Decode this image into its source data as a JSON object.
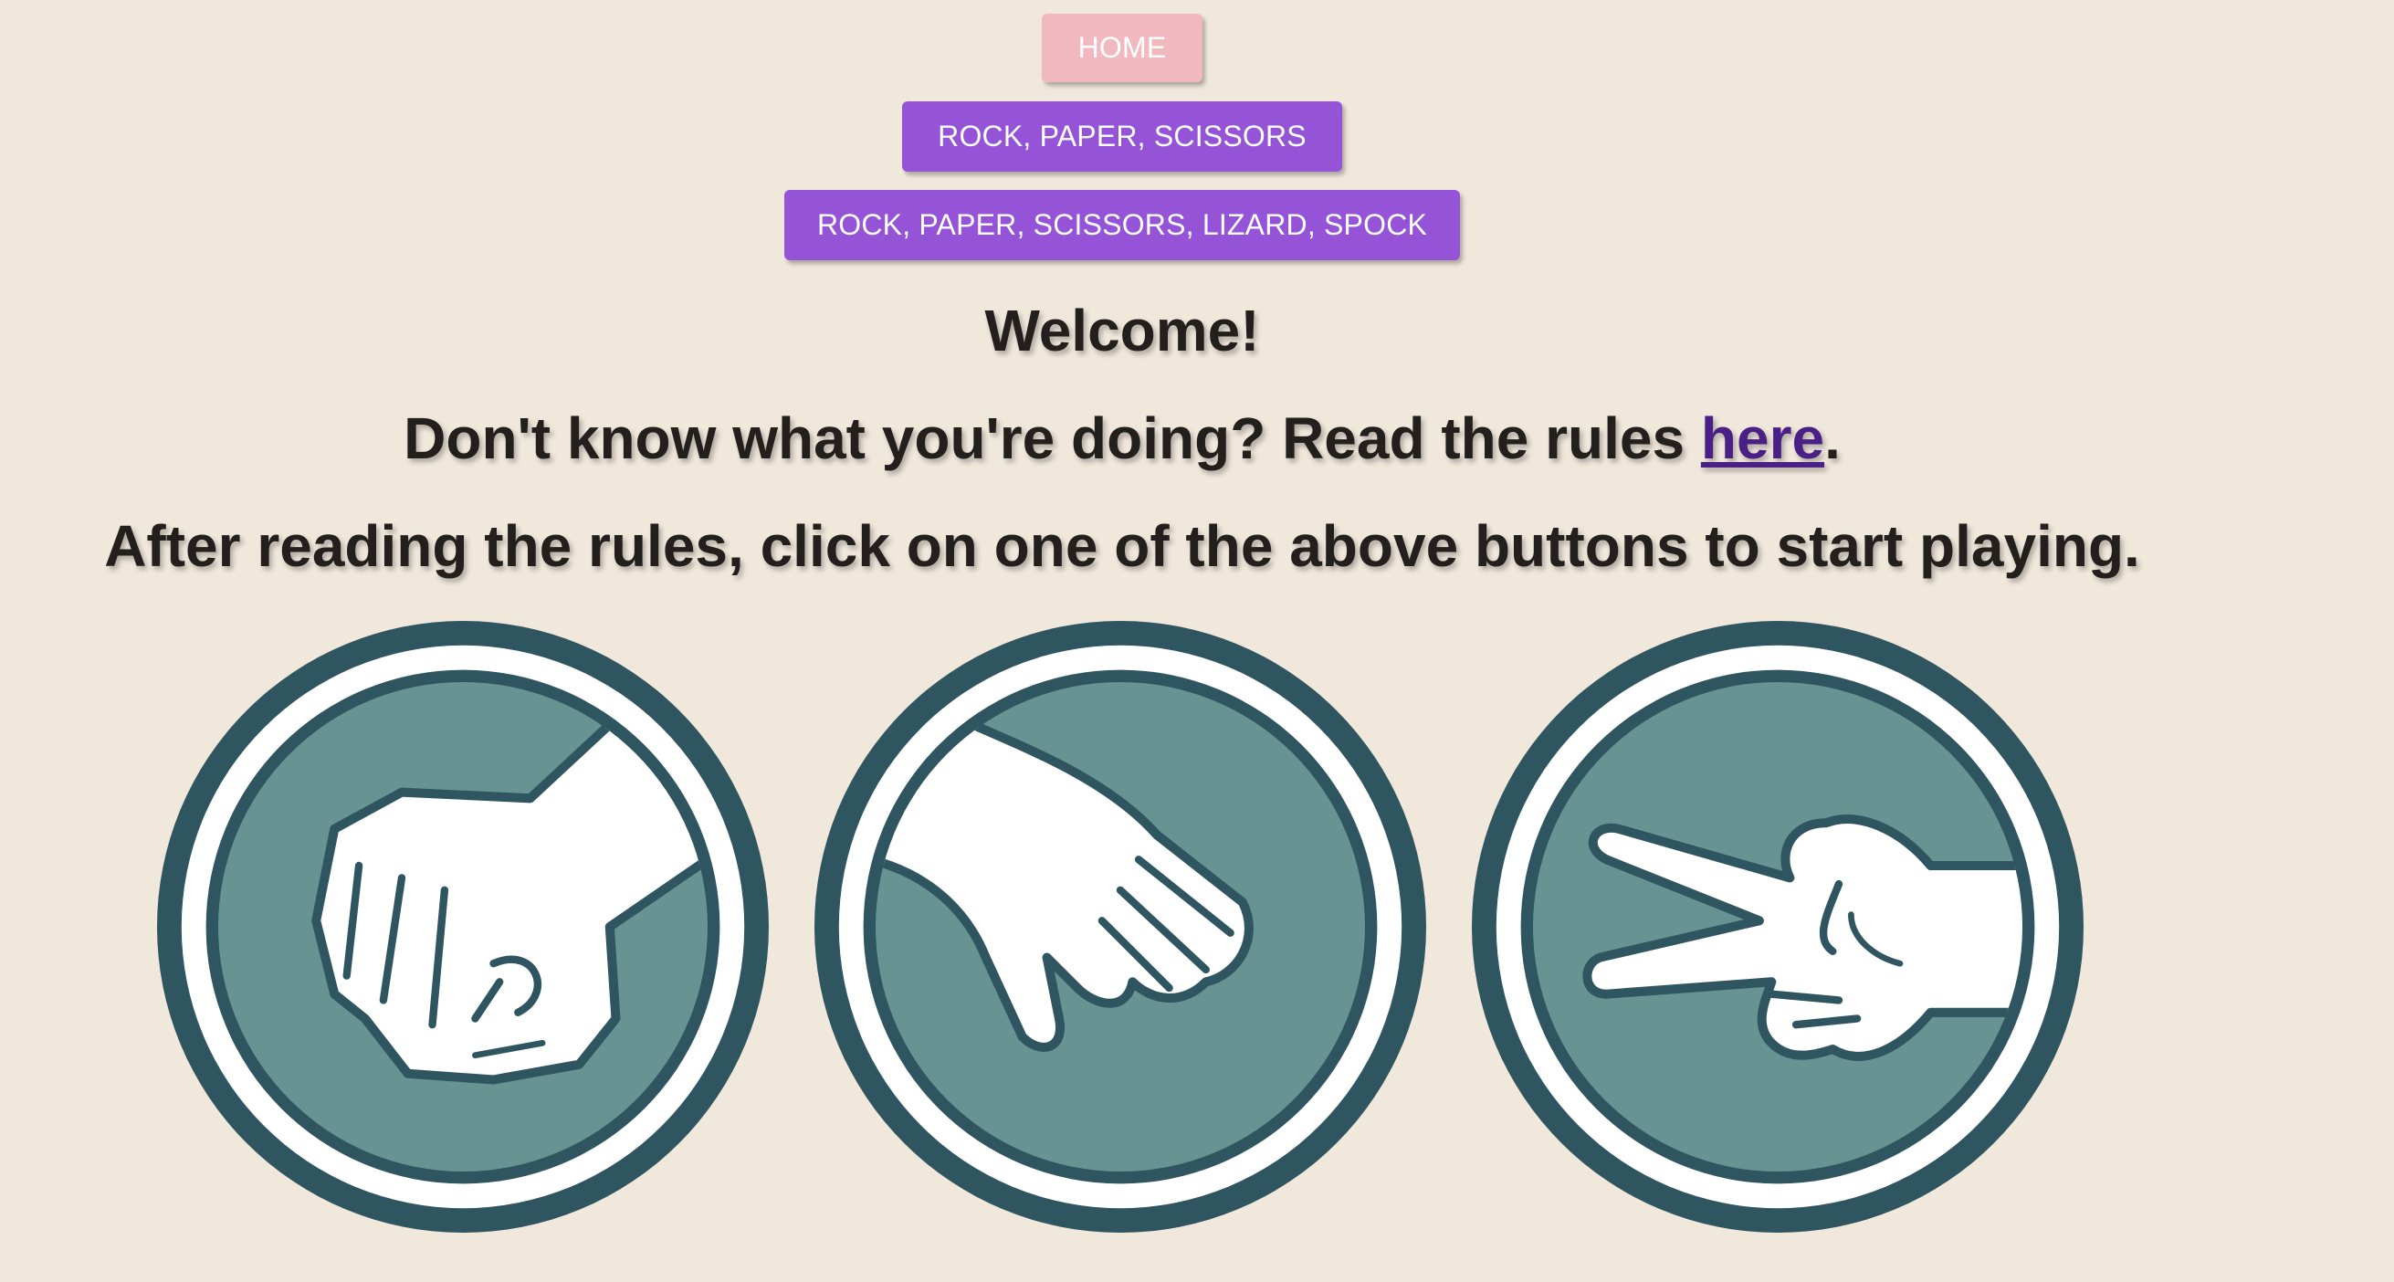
{
  "nav": {
    "home_label": "HOME",
    "rps_label": "ROCK, PAPER, SCISSORS",
    "rpsls_label": "ROCK, PAPER, SCISSORS, LIZARD, SPOCK"
  },
  "content": {
    "welcome": "Welcome!",
    "rules_prefix": "Don't know what you're doing? Read the rules ",
    "rules_link": "here",
    "rules_suffix": ".",
    "start_text": "After reading the rules, click on one of the above buttons to start playing."
  },
  "images": {
    "items": [
      "rock-hand-icon",
      "paper-hand-icon",
      "scissors-hand-icon"
    ]
  },
  "colors": {
    "background": "#f1e8dc",
    "home_button": "#f2b8c0",
    "game_button": "#9553d8",
    "link": "#4a1f86",
    "text": "#231f1d",
    "circle_dark": "#2f5560",
    "circle_fill": "#679493"
  }
}
